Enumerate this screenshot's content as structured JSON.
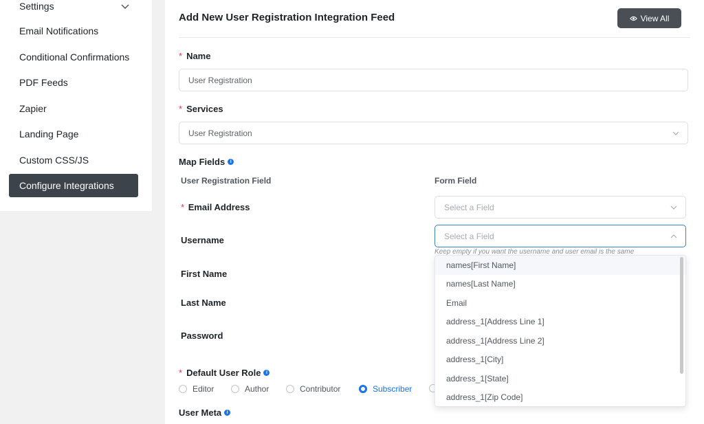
{
  "sidebar": {
    "items": [
      {
        "label": "Settings",
        "has_chevron": true
      },
      {
        "label": "Email Notifications"
      },
      {
        "label": "Conditional Confirmations"
      },
      {
        "label": "PDF Feeds"
      },
      {
        "label": "Zapier"
      },
      {
        "label": "Landing Page"
      },
      {
        "label": "Custom CSS/JS"
      },
      {
        "label": "Configure Integrations",
        "active": true
      }
    ]
  },
  "header": {
    "title": "Add New User Registration Integration Feed",
    "view_all_label": "View All",
    "view_all_icon": "eye-icon"
  },
  "form": {
    "name_label": "Name",
    "name_value": "User Registration",
    "services_label": "Services",
    "services_value": "User Registration",
    "map_fields_label": "Map Fields",
    "col_reg_field": "User Registration Field",
    "col_form_field": "Form Field",
    "fields": {
      "email_label": "Email Address",
      "email_placeholder": "Select a Field",
      "username_label": "Username",
      "username_placeholder": "Select a Field",
      "username_hint": "Keep empty if you want the username and user email is the same",
      "first_name_label": "First Name",
      "last_name_label": "Last Name",
      "password_label": "Password"
    },
    "default_role_label": "Default User Role",
    "roles": [
      "Editor",
      "Author",
      "Contributor",
      "Subscriber"
    ],
    "selected_role": "Subscriber",
    "user_meta_label": "User Meta"
  },
  "dropdown": {
    "options": [
      "names[First Name]",
      "names[Last Name]",
      "Email",
      "address_1[Address Line 1]",
      "address_1[Address Line 2]",
      "address_1[City]",
      "address_1[State]",
      "address_1[Zip Code]"
    ],
    "hovered": "names[First Name]"
  },
  "colors": {
    "accent": "#1a73e8",
    "required": "#e63946",
    "active_nav": "#3c434a",
    "button": "#4a4f55"
  }
}
